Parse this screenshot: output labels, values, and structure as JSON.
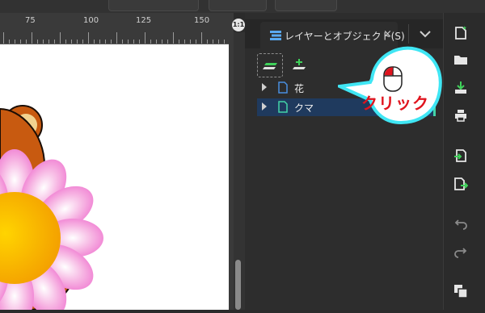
{
  "ruler": {
    "ticks": [
      "75",
      "100",
      "125",
      "150"
    ]
  },
  "zoom_button": {
    "label": "1:1"
  },
  "panel": {
    "tab_label": "レイヤーとオブジェクト(S)",
    "tab_close": "×",
    "layers": [
      {
        "label": "花",
        "expanded": false,
        "selected": false
      },
      {
        "label": "クマ",
        "expanded": false,
        "selected": true
      }
    ]
  },
  "callout": {
    "text": "クリック",
    "icon": "mouse-left-click-icon"
  },
  "right_toolbar": {
    "icons": [
      "new-document-icon",
      "open-folder-icon",
      "save-icon",
      "print-icon",
      "import-icon",
      "export-icon",
      "undo-icon",
      "redo-icon",
      "duplicate-icon"
    ]
  },
  "colors": {
    "accent_green": "#43d4a8",
    "selection_blue": "#1f3a5e",
    "callout_cyan": "#3fe6f4",
    "click_red": "#e0141e",
    "doc_icon_blue": "#4a8fe0"
  }
}
